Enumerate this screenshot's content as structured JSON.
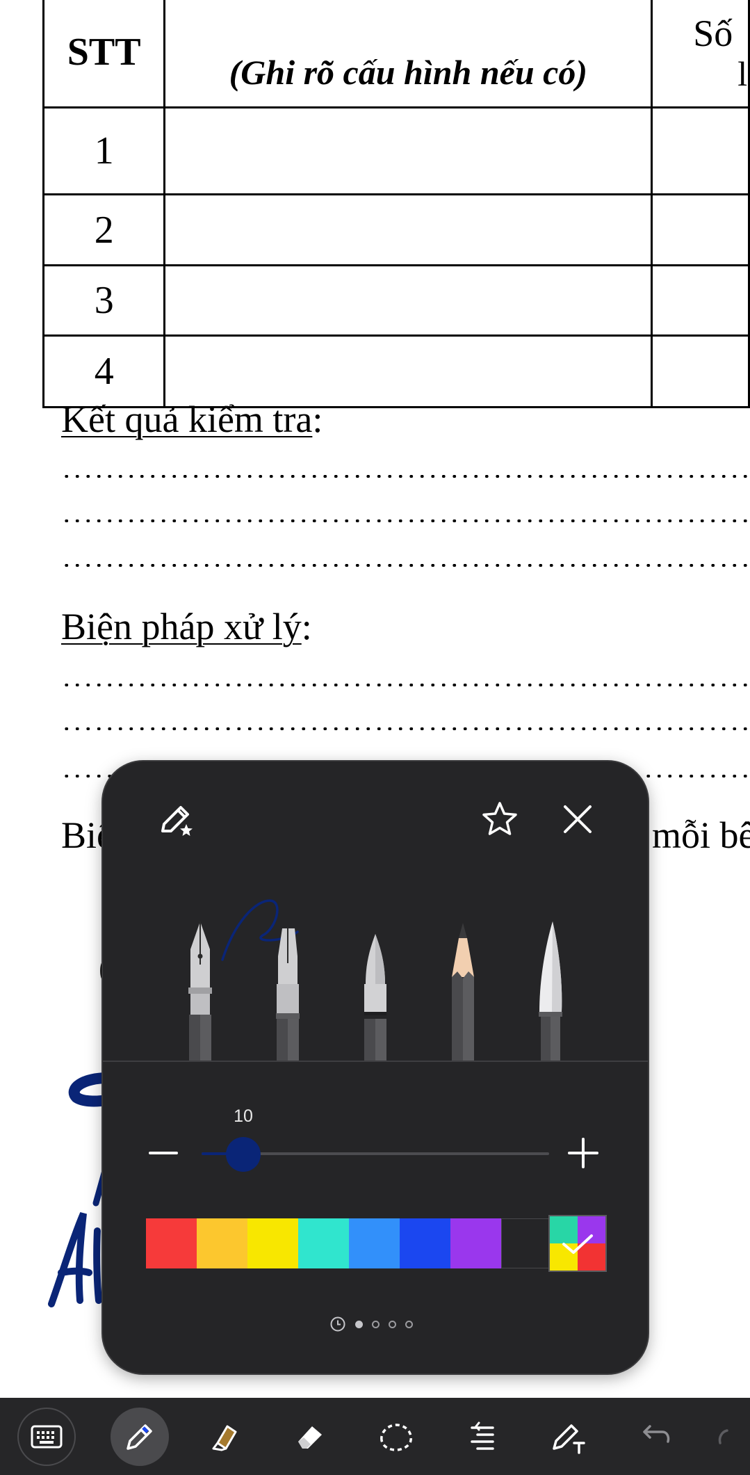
{
  "table": {
    "header": {
      "stt": "STT",
      "description_note": "(Ghi rõ cấu hình nếu có)",
      "qty_partial_top": "Số",
      "qty_partial_bottom": "l"
    },
    "rows": [
      "1",
      "2",
      "3",
      "4"
    ]
  },
  "sections": {
    "ket_qua": {
      "title": "Kết quả kiểm tra",
      "colon": ":"
    },
    "bien_phap": {
      "title": "Biện pháp xử lý",
      "colon": ":"
    },
    "partial_left": "Biế",
    "partial_right": "mỗi bê"
  },
  "pen_panel": {
    "size_value": "10",
    "slider": {
      "value": 10,
      "fraction": 0.12
    },
    "colors": [
      "#f63a3a",
      "#fcc72e",
      "#f8e700",
      "#30e5ce",
      "#3290fa",
      "#1b47f0",
      "#9a37ed",
      "#252527"
    ],
    "custom_colors": [
      "#28d6a6",
      "#9a37ed",
      "#f8e700",
      "#f23333"
    ],
    "ink_color": "#0a2577",
    "pens": [
      "fountain-pen-icon",
      "calligraphy-pen-icon",
      "pen-icon",
      "pencil-icon",
      "brush-icon"
    ],
    "pager": {
      "pages": 4,
      "active": 0,
      "recent_icon": "clock-icon"
    }
  },
  "toolbar": {
    "items": [
      "keyboard-icon",
      "pen-icon",
      "highlighter-icon",
      "eraser-icon",
      "lasso-icon",
      "text-align-icon",
      "pen-to-text-icon",
      "undo-icon",
      "redo-icon"
    ],
    "active": "pen-icon"
  }
}
